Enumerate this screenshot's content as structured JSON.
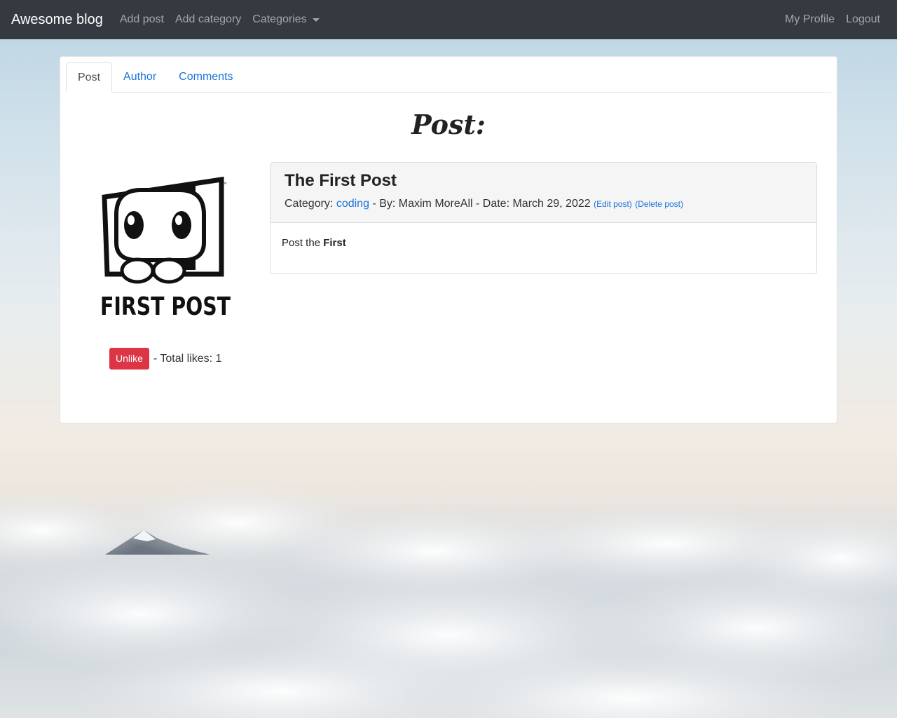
{
  "navbar": {
    "brand": "Awesome blog",
    "links": {
      "add_post": "Add post",
      "add_category": "Add category",
      "categories": "Categories"
    },
    "right": {
      "profile": "My Profile",
      "logout": "Logout"
    }
  },
  "tabs": {
    "post": "Post",
    "author": "Author",
    "comments": "Comments"
  },
  "page_title": "Post:",
  "logo": {
    "icon": "first-post-mascot",
    "text": "FIRST POST",
    "tm": "™"
  },
  "likes": {
    "button": "Unlike",
    "text": "- Total likes: 1"
  },
  "post": {
    "title": "The First Post",
    "category_label": "Category:",
    "category": "coding",
    "by_label": "- By: Maxim MoreAll - Date: March 29, 2022",
    "edit_link": "(Edit post)",
    "delete_link": "(Delete post)",
    "body_prefix": "Post the",
    "body_bold": "First"
  },
  "colors": {
    "navbar": "#343a40",
    "link": "#1a73d9",
    "danger": "#dc3545"
  }
}
